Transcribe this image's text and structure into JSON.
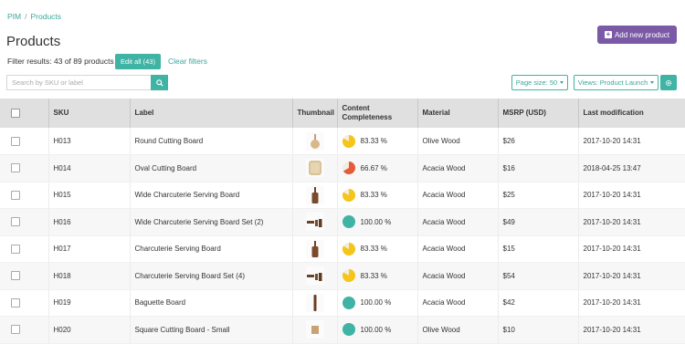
{
  "breadcrumb": {
    "root": "PIM",
    "sep": "/",
    "current": "Products"
  },
  "page_title": "Products",
  "add_button": "Add new product",
  "filter_results": "Filter results: 43 of 89 products",
  "edit_all": "Edit all (43)",
  "clear_filters": "Clear filters",
  "search": {
    "placeholder": "Search by SKU or label"
  },
  "page_size": "Page size: 50",
  "views": "Views: Product Launch",
  "colors": {
    "accent": "#3fb3a4",
    "brand": "#7a5aa6",
    "yellow": "#f5c518",
    "red": "#e55b3c",
    "teal": "#3fb3a4"
  },
  "columns": [
    "SKU",
    "Label",
    "Thumbnail",
    "Content Completeness",
    "Material",
    "MSRP (USD)",
    "Last modification"
  ],
  "rows": [
    {
      "sku": "H013",
      "label": "Round Cutting Board",
      "thumb": "round-board",
      "pct": 83.33,
      "completeness": "83.33 %",
      "material": "Olive Wood",
      "msrp": "$26",
      "modified": "2017-10-20 14:31"
    },
    {
      "sku": "H014",
      "label": "Oval Cutting Board",
      "thumb": "oval-board",
      "pct": 66.67,
      "completeness": "66.67 %",
      "material": "Acacia Wood",
      "msrp": "$16",
      "modified": "2018-04-25 13:47"
    },
    {
      "sku": "H015",
      "label": "Wide Charcuterie Serving Board",
      "thumb": "paddle-board",
      "pct": 83.33,
      "completeness": "83.33 %",
      "material": "Acacia Wood",
      "msrp": "$25",
      "modified": "2017-10-20 14:31"
    },
    {
      "sku": "H016",
      "label": "Wide Charcuterie Serving Board Set (2)",
      "thumb": "board-set",
      "pct": 100,
      "completeness": "100.00 %",
      "material": "Acacia Wood",
      "msrp": "$49",
      "modified": "2017-10-20 14:31"
    },
    {
      "sku": "H017",
      "label": "Charcuterie Serving Board",
      "thumb": "paddle-board",
      "pct": 83.33,
      "completeness": "83.33 %",
      "material": "Acacia Wood",
      "msrp": "$15",
      "modified": "2017-10-20 14:31"
    },
    {
      "sku": "H018",
      "label": "Charcuterie Serving Board Set (4)",
      "thumb": "board-set",
      "pct": 83.33,
      "completeness": "83.33 %",
      "material": "Acacia Wood",
      "msrp": "$54",
      "modified": "2017-10-20 14:31"
    },
    {
      "sku": "H019",
      "label": "Baguette Board",
      "thumb": "long-board",
      "pct": 100,
      "completeness": "100.00 %",
      "material": "Acacia Wood",
      "msrp": "$42",
      "modified": "2017-10-20 14:31"
    },
    {
      "sku": "H020",
      "label": "Square Cutting Board - Small",
      "thumb": "square-board",
      "pct": 100,
      "completeness": "100.00 %",
      "material": "Olive Wood",
      "msrp": "$10",
      "modified": "2017-10-20 14:31"
    }
  ]
}
